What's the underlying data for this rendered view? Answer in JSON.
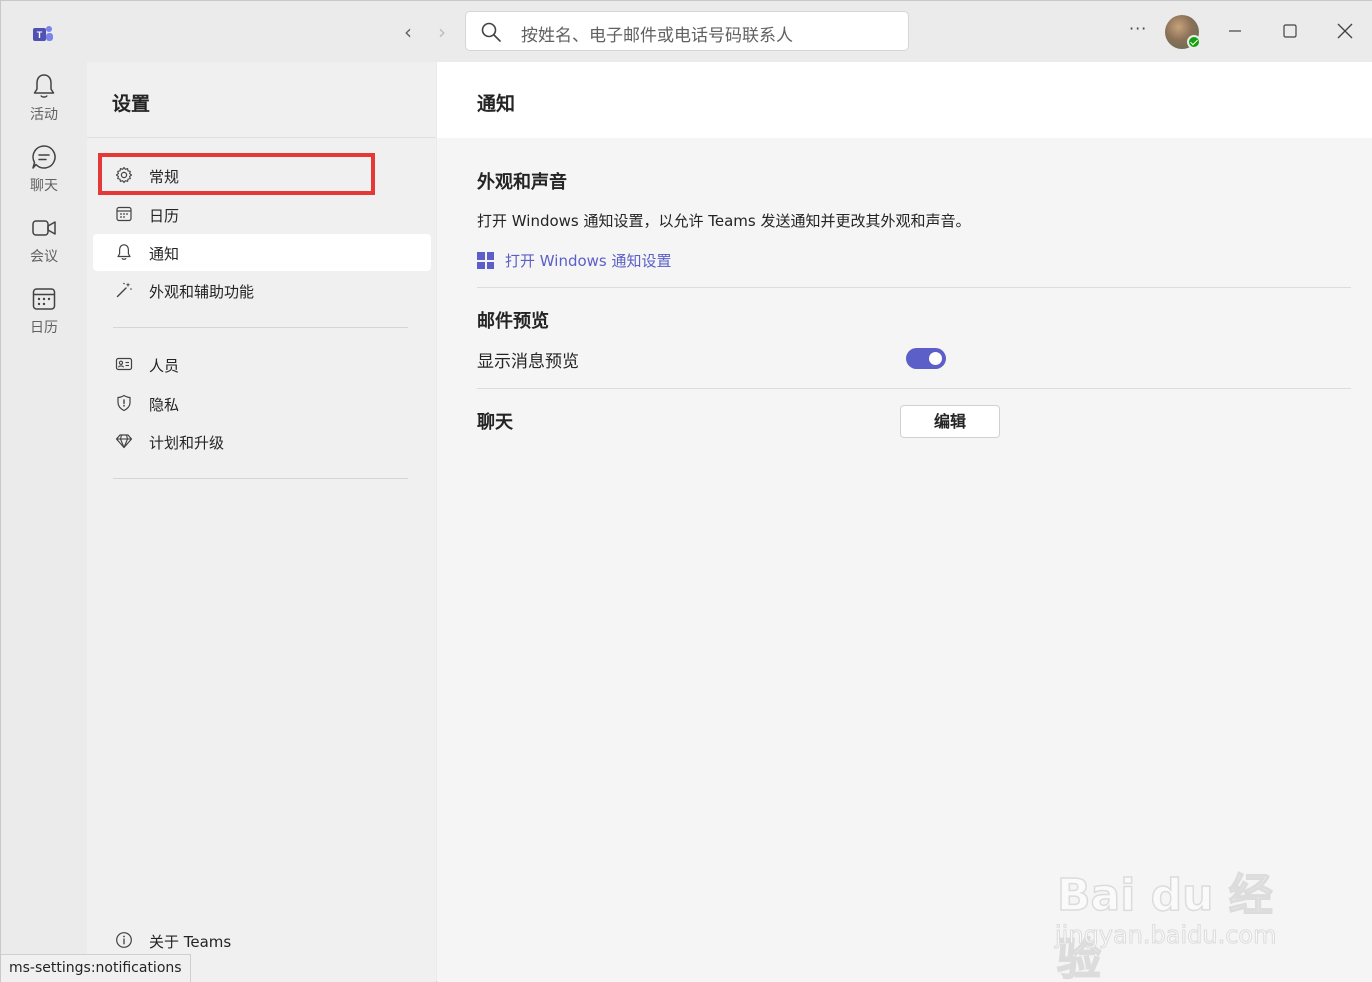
{
  "titlebar": {
    "search_placeholder": "按姓名、电子邮件或电话号码联系人",
    "more_label": "···"
  },
  "rail": {
    "items": [
      {
        "label": "活动",
        "icon": "bell-icon"
      },
      {
        "label": "聊天",
        "icon": "chat-icon"
      },
      {
        "label": "会议",
        "icon": "video-icon"
      },
      {
        "label": "日历",
        "icon": "calendar-icon"
      }
    ]
  },
  "settings": {
    "title": "设置",
    "menu": [
      {
        "label": "常规",
        "icon": "gear-icon"
      },
      {
        "label": "日历",
        "icon": "calendar-icon"
      },
      {
        "label": "通知",
        "icon": "bell-icon",
        "active": true
      },
      {
        "label": "外观和辅助功能",
        "icon": "magic-wand-icon"
      },
      {
        "label": "人员",
        "icon": "contact-card-icon"
      },
      {
        "label": "隐私",
        "icon": "shield-icon"
      },
      {
        "label": "计划和升级",
        "icon": "diamond-icon"
      }
    ],
    "about": {
      "label": "关于 Teams",
      "icon": "info-icon"
    }
  },
  "content": {
    "title": "通知",
    "appearance_section": {
      "title": "外观和声音",
      "description": "打开 Windows 通知设置，以允许 Teams 发送通知并更改其外观和声音。",
      "link": "打开 Windows 通知设置"
    },
    "email_section": {
      "title": "邮件预览",
      "toggle_label": "显示消息预览",
      "toggle_on": true
    },
    "chat_section": {
      "title": "聊天",
      "button": "编辑"
    }
  },
  "watermark": {
    "brand": "Bai du 经验",
    "url": "jingyan.baidu.com"
  },
  "status_url": "ms-settings:notifications",
  "colors": {
    "accent": "#5b5fc7",
    "highlight": "#e53935",
    "presence": "#13a10e"
  }
}
